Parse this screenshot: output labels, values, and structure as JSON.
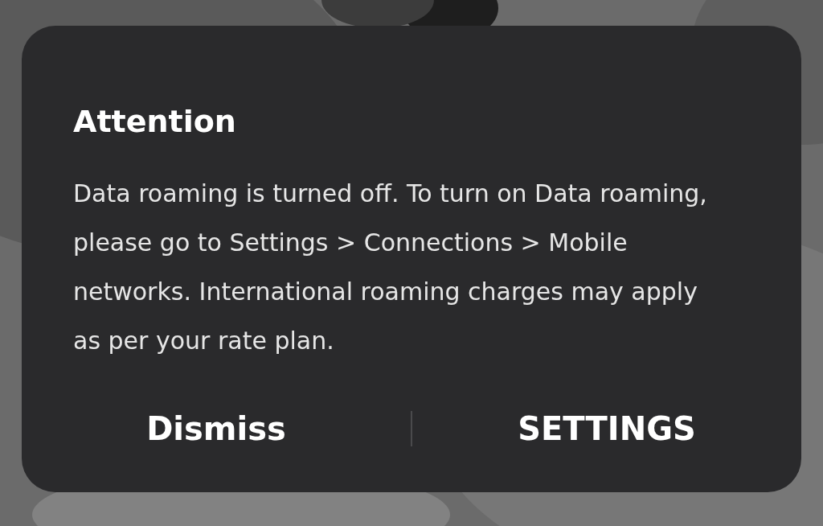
{
  "dialog": {
    "title": "Attention",
    "message": "Data roaming is turned off. To turn on Data roaming, please go to Settings > Connections > Mobile networks. International roaming charges may apply as per your rate plan.",
    "buttons": [
      {
        "label": "Dismiss"
      },
      {
        "label": "SETTINGS"
      }
    ]
  }
}
